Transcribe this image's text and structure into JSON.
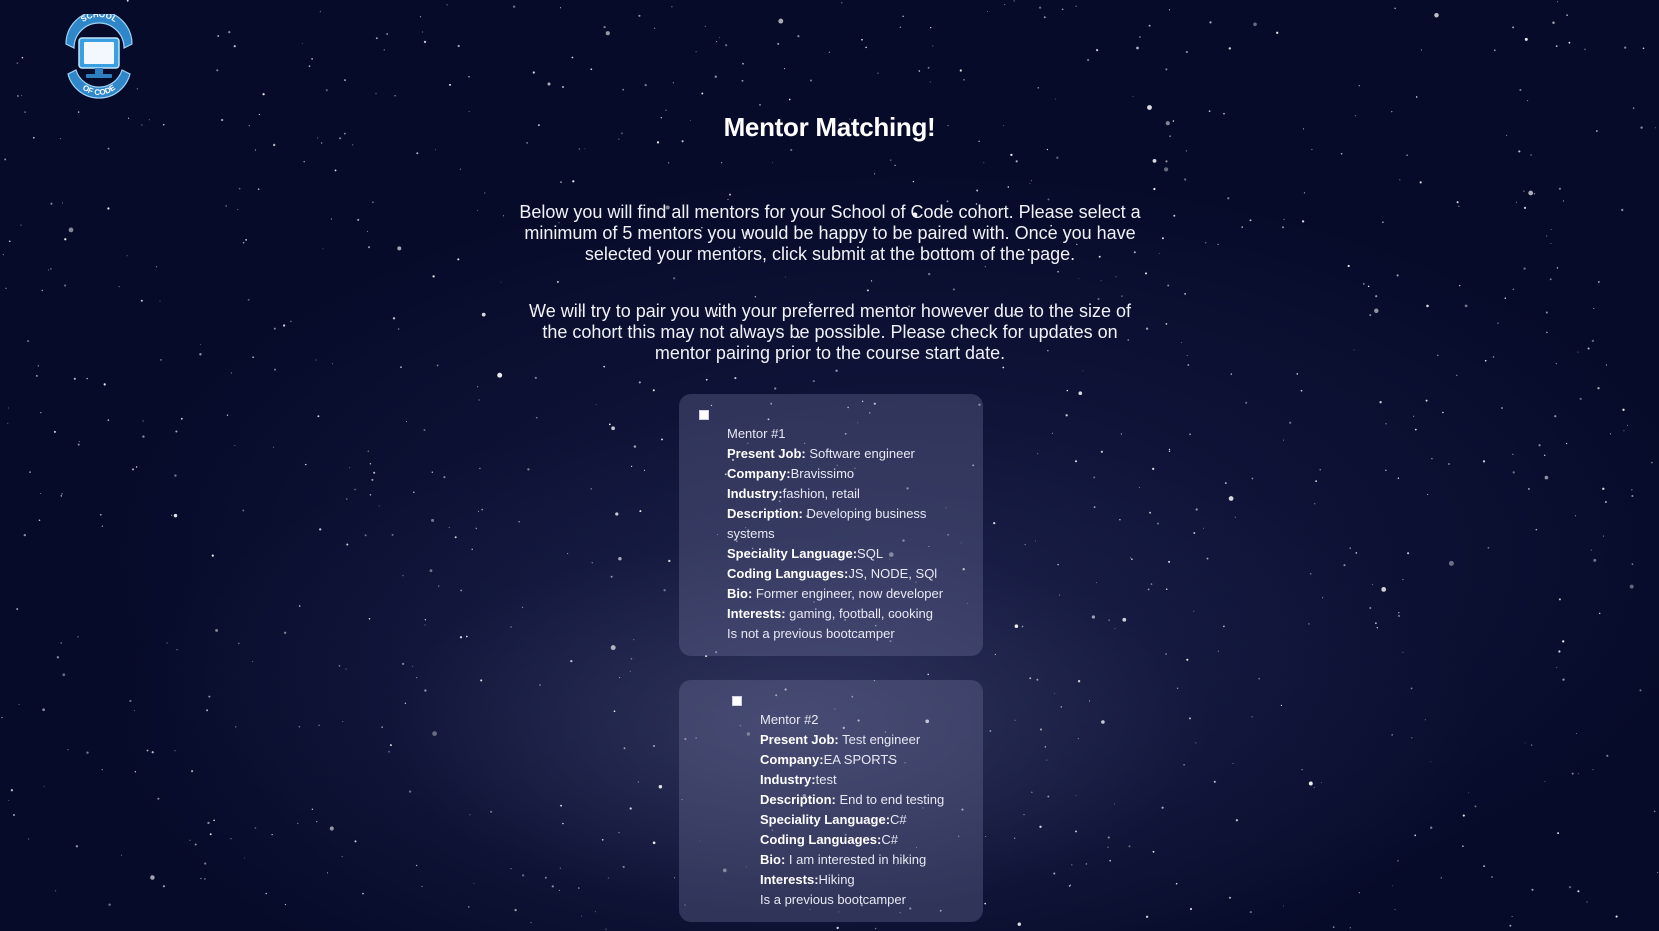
{
  "logo": {
    "top_text": "SCHOOL",
    "bottom_text": "OF CODE",
    "icon": "computer-monitor-icon"
  },
  "page": {
    "title": "Mentor Matching!",
    "intro_1": "Below you will find all mentors for your School of Code cohort. Please select a minimum of 5 mentors you would be happy to be paired with. Once you have selected your mentors, click submit at the bottom of the page.",
    "intro_2": "We will try to pair you with your preferred mentor however due to the size of the cohort this may not always be possible. Please check for updates on mentor pairing prior to the course start date."
  },
  "mentors": [
    {
      "heading": "Mentor #1",
      "present_job_label": "Present Job:",
      "present_job": " Software engineer",
      "company_label": "Company:",
      "company": "Bravissimo",
      "industry_label": "Industry:",
      "industry": "fashion, retail",
      "description_label": "Description:",
      "description": " Developing business systems",
      "speciality_label": "Speciality Language:",
      "speciality": "SQL",
      "coding_label": "Coding Languages:",
      "coding": "JS, NODE, SQl",
      "bio_label": "Bio:",
      "bio": " Former engineer, now developer",
      "interests_label": "Interests:",
      "interests": " gaming, football, cooking",
      "bootcamper": "Is not a previous bootcamper"
    },
    {
      "heading": "Mentor #2",
      "present_job_label": "Present Job:",
      "present_job": " Test engineer",
      "company_label": "Company:",
      "company": "EA SPORTS",
      "industry_label": "Industry:",
      "industry": "test",
      "description_label": "Description:",
      "description": " End to end testing",
      "speciality_label": "Speciality Language:",
      "speciality": "C#",
      "coding_label": "Coding Languages:",
      "coding": "C#",
      "bio_label": "Bio:",
      "bio": " I am interested in hiking",
      "interests_label": "Interests:",
      "interests": "Hiking",
      "bootcamper": "Is a previous bootcamper"
    }
  ],
  "colors": {
    "background": "#070b2a",
    "card": "#4a4f78",
    "logo_blue": "#3aa0e0"
  }
}
